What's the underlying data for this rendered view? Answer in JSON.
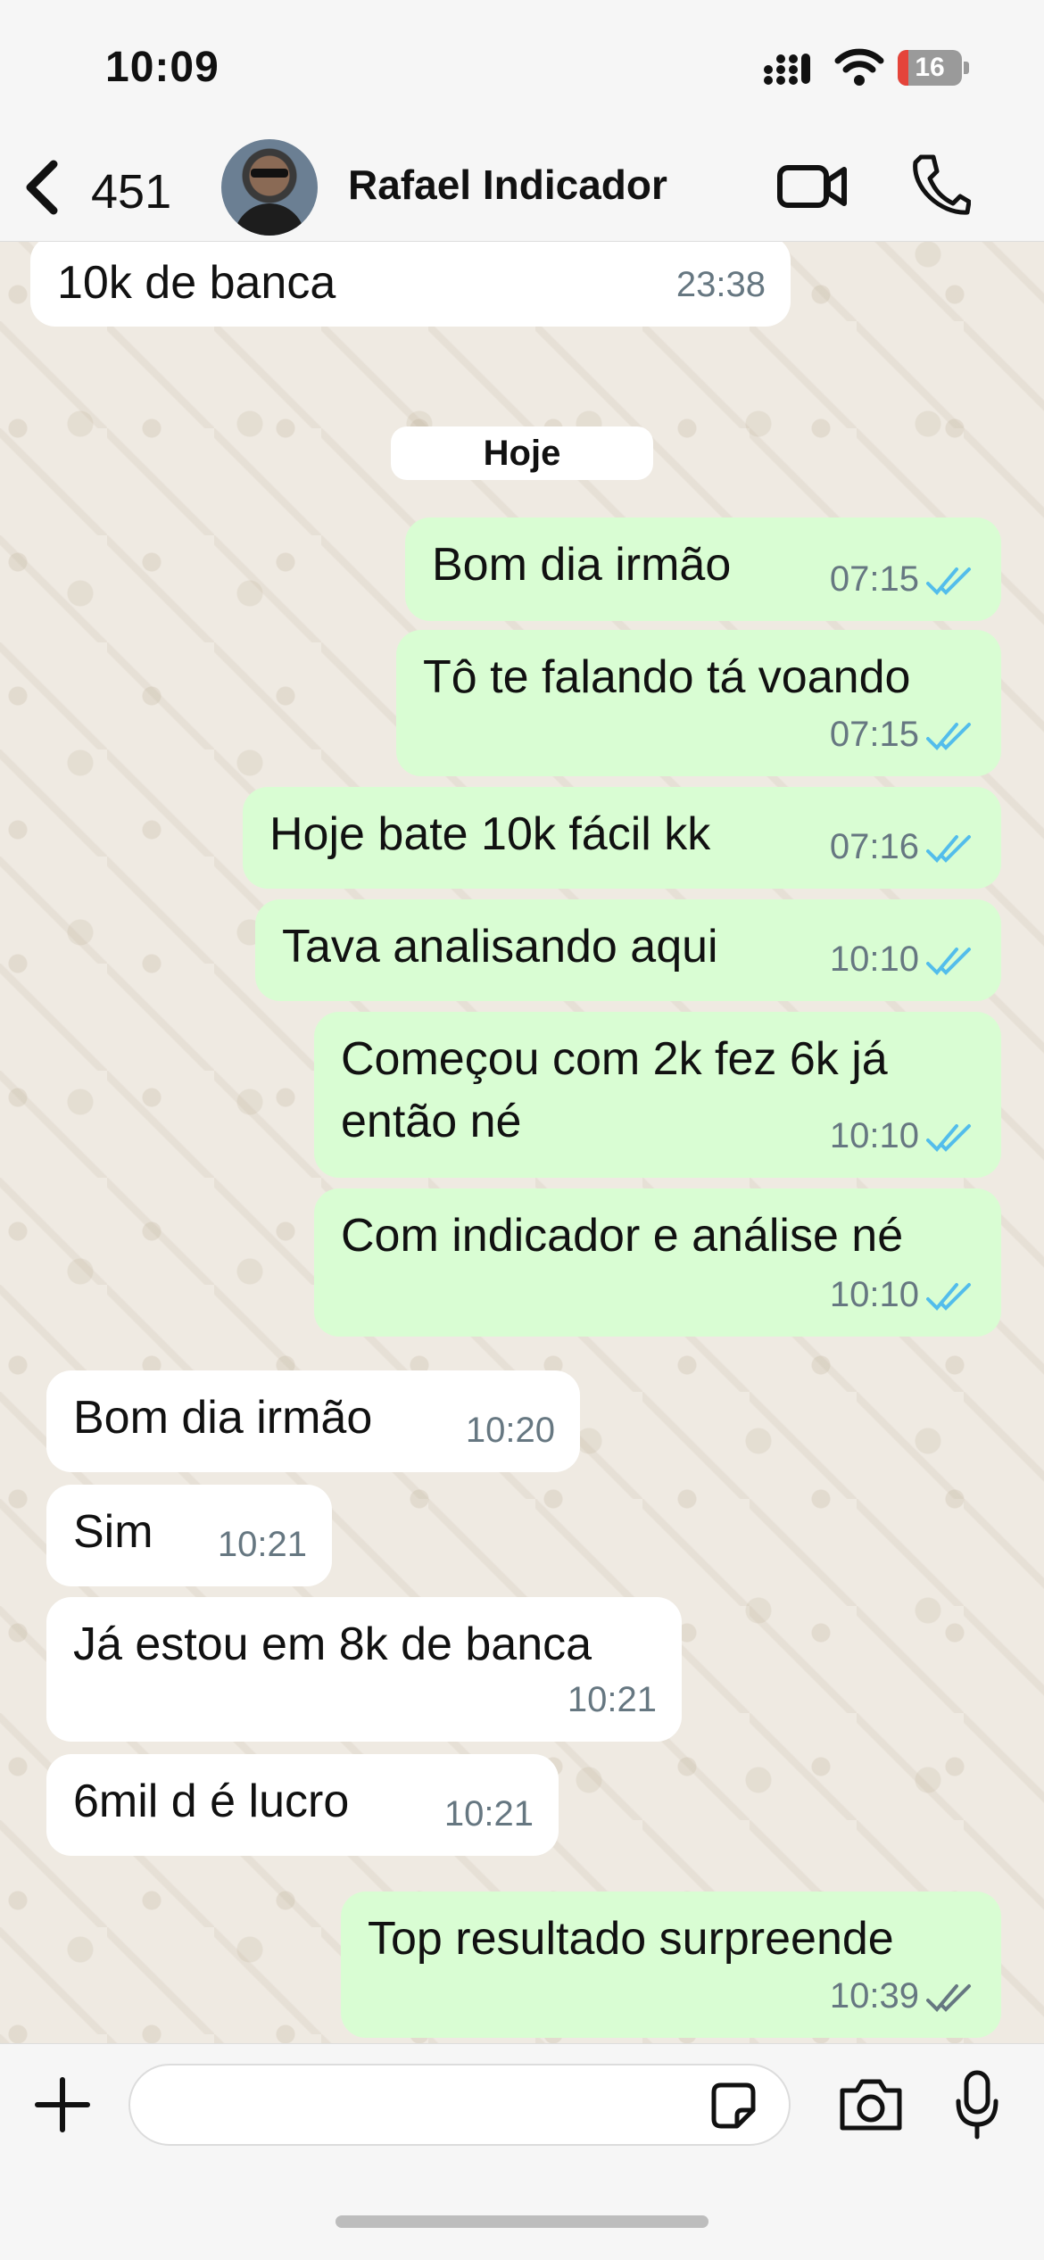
{
  "status_bar": {
    "time": "10:09",
    "battery": "16",
    "battery_level_percent": 16
  },
  "header": {
    "back_count": "451",
    "contact_name": "Rafael Indicador"
  },
  "date_separator": "Hoje",
  "messages": [
    {
      "text": "10k de banca",
      "time": "23:38",
      "direction": "incoming"
    },
    {
      "text": "Bom dia irmão",
      "time": "07:15",
      "direction": "outgoing",
      "status": "read"
    },
    {
      "text": "Tô te falando tá voando",
      "time": "07:15",
      "direction": "outgoing",
      "status": "read"
    },
    {
      "text": "Hoje bate 10k fácil kk",
      "time": "07:16",
      "direction": "outgoing",
      "status": "read"
    },
    {
      "text": "Tava analisando aqui",
      "time": "10:10",
      "direction": "outgoing",
      "status": "read"
    },
    {
      "text": "Começou com 2k fez 6k já então né",
      "time": "10:10",
      "direction": "outgoing",
      "status": "read"
    },
    {
      "text": "Com indicador e análise né",
      "time": "10:10",
      "direction": "outgoing",
      "status": "read"
    },
    {
      "text": "Bom dia irmão",
      "time": "10:20",
      "direction": "incoming"
    },
    {
      "text": "Sim",
      "time": "10:21",
      "direction": "incoming"
    },
    {
      "text": "Já estou em 8k de banca",
      "time": "10:21",
      "direction": "incoming"
    },
    {
      "text": "6mil d é lucro",
      "time": "10:21",
      "direction": "incoming"
    },
    {
      "text": "Top resultado surpreende",
      "time": "10:39",
      "direction": "outgoing",
      "status": "delivered"
    }
  ],
  "composer": {
    "value": ""
  },
  "colors": {
    "chat_background": "#efeae2",
    "incoming_bubble": "#ffffff",
    "outgoing_bubble": "#d9fdd3",
    "read_ticks": "#53bdeb",
    "delivered_ticks": "#667781",
    "battery_low": "#e5443a"
  },
  "icons": [
    "back-chevron-icon",
    "video-camera-icon",
    "phone-icon",
    "plus-icon",
    "sticker-icon",
    "camera-icon",
    "microphone-icon",
    "double-check-icon"
  ]
}
